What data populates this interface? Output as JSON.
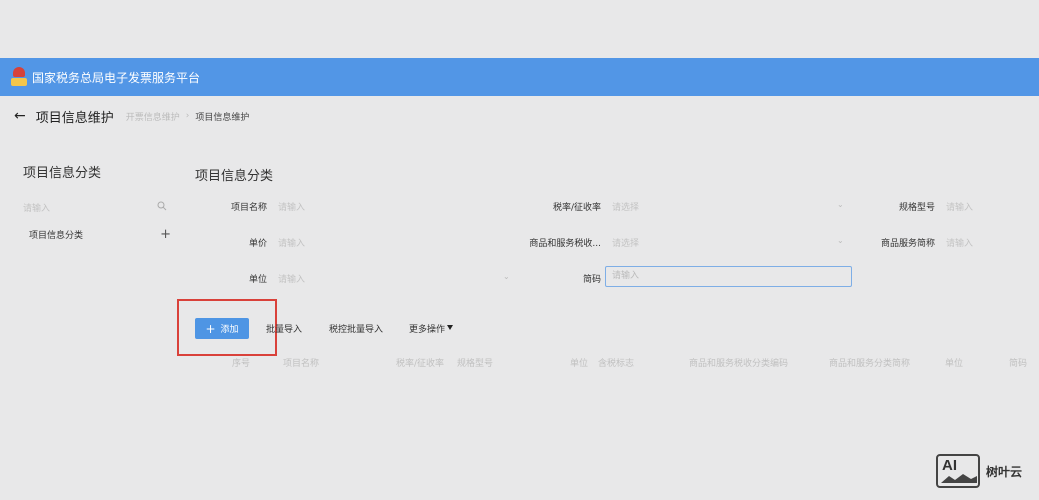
{
  "header": {
    "app_title": "国家税务总局电子发票服务平台",
    "logo_icon": "tax-bureau-emblem-icon"
  },
  "titlebar": {
    "page_title": "项目信息维护",
    "breadcrumb": [
      "开票信息维护",
      "项目信息维护"
    ],
    "back_icon": "arrow-left-icon"
  },
  "sidebar": {
    "title": "项目信息分类",
    "search_placeholder": "请输入",
    "items": [
      {
        "label": "项目信息分类"
      }
    ]
  },
  "main": {
    "title": "项目信息分类",
    "filters": {
      "item_name": {
        "label": "项目名称",
        "placeholder": "请输入"
      },
      "tax_rate": {
        "label": "税率/征收率",
        "placeholder": "请选择"
      },
      "spec_model": {
        "label": "规格型号",
        "placeholder": "请输入"
      },
      "unit_price": {
        "label": "单价",
        "placeholder": "请输入"
      },
      "tax_code": {
        "label": "商品和服务税收...",
        "placeholder": "请选择"
      },
      "service_abbr": {
        "label": "商品服务简称",
        "placeholder": "请输入"
      },
      "unit": {
        "label": "单位",
        "placeholder": "请输入"
      },
      "short_code": {
        "label": "简码",
        "placeholder": "请输入"
      }
    },
    "toolbar": {
      "add": "添加",
      "batch_import": "批量导入",
      "tax_control_import": "税控批量导入",
      "more": "更多操作"
    },
    "table_headers": [
      "序号",
      "项目名称",
      "税率/征收率",
      "规格型号",
      "单位",
      "含税标志",
      "商品和服务税收分类编码",
      "商品和服务分类简称",
      "单位",
      "简码"
    ]
  },
  "watermark": {
    "badge": "AI",
    "text": "树叶云"
  },
  "colors": {
    "header_bg": "#5296e6",
    "primary_button": "#4e95e4",
    "highlight_border": "#d9413a",
    "page_bg": "#e8e8e9"
  }
}
